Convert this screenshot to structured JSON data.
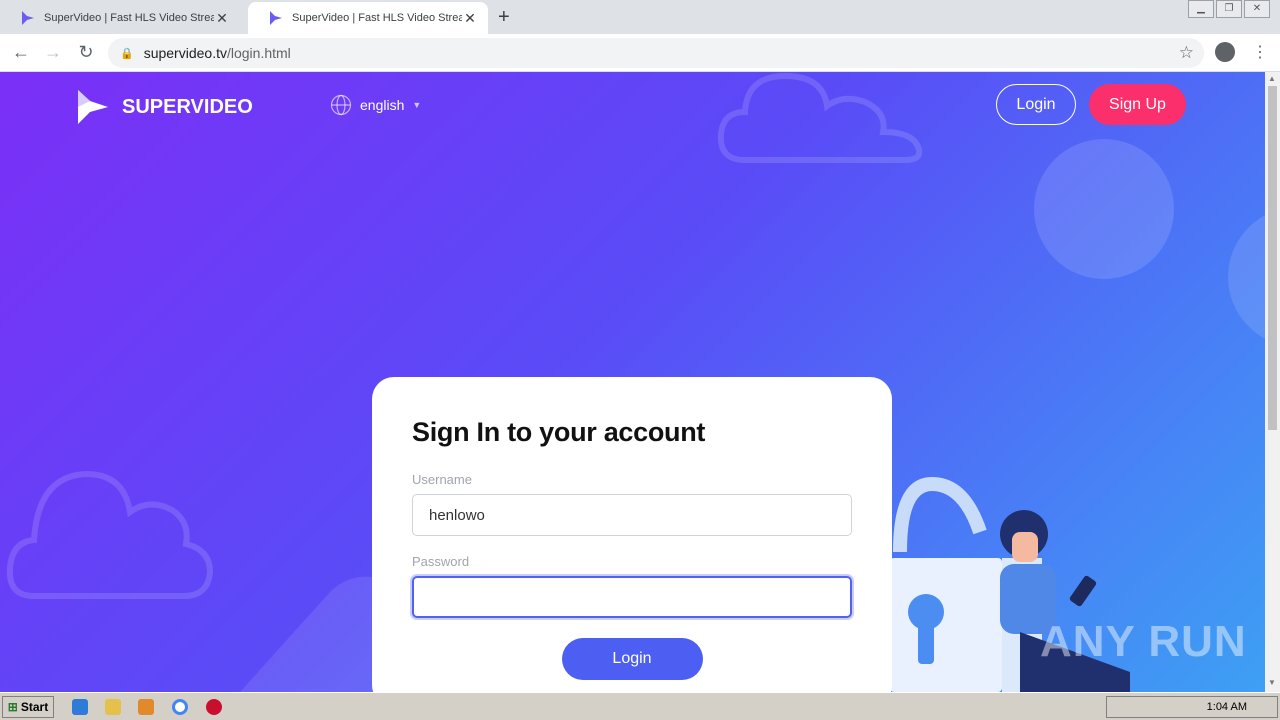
{
  "browser": {
    "tabs": [
      {
        "title": "SuperVideo | Fast HLS Video Streaming"
      },
      {
        "title": "SuperVideo | Fast HLS Video Streaming"
      }
    ],
    "url_host": "supervideo.tv",
    "url_path": "/login.html"
  },
  "header": {
    "brand": "SUPERVIDEO",
    "language": "english",
    "login_label": "Login",
    "signup_label": "Sign Up"
  },
  "login_form": {
    "title": "Sign In to your account",
    "username_label": "Username",
    "username_value": "henlowo",
    "password_label": "Password",
    "password_value": "",
    "submit_label": "Login"
  },
  "watermark": "ANY RUN",
  "taskbar": {
    "start_label": "Start",
    "clock": "1:04 AM"
  },
  "colors": {
    "signup_accent": "#fb2f6b",
    "login_button": "#4d5ef2"
  }
}
